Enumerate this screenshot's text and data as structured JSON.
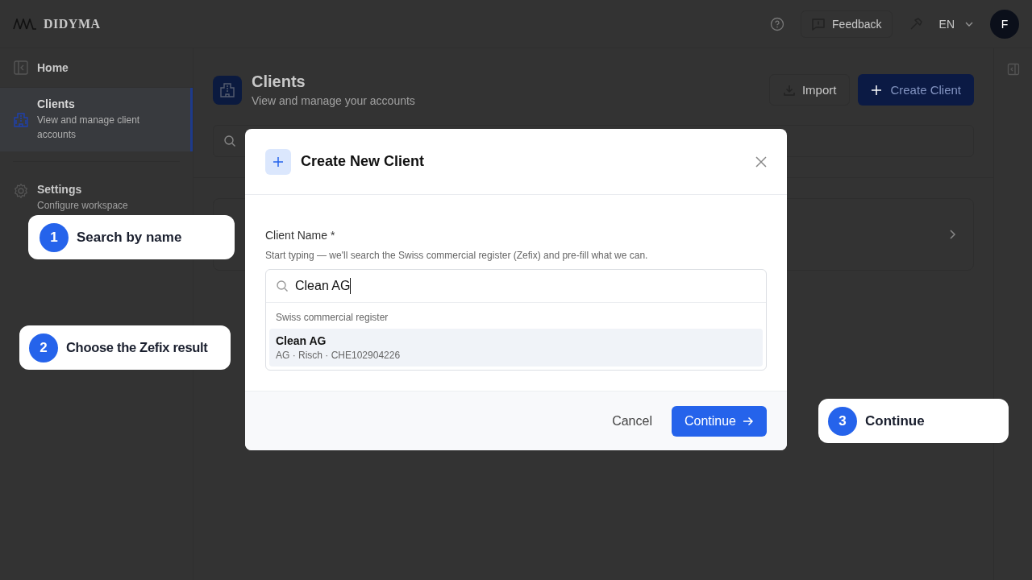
{
  "header": {
    "logo": "DIDYMA",
    "feedback": "Feedback",
    "language": "EN",
    "avatar": "F"
  },
  "sidebar": {
    "items": [
      {
        "kind": "home",
        "label": "Home",
        "selected": false
      },
      {
        "kind": "clients",
        "label": "Clients",
        "subtitle": "View and manage client accounts",
        "selected": true
      },
      {
        "kind": "settings",
        "label": "Settings",
        "subtitle": "Configure workspace",
        "selected": false
      }
    ]
  },
  "page": {
    "title": "Clients",
    "subtitle": "View and manage your accounts",
    "import_button": "Import",
    "create_button": "Create Client"
  },
  "dialog": {
    "title": "Create New Client",
    "field_label": "Client Name *",
    "hint": "Start typing — we'll search the Swiss commercial register (Zefix) and pre-fill what we can.",
    "value": "Clean AG",
    "group": "Swiss commercial register",
    "results": [
      {
        "name": "Clean AG",
        "detail": "AG · Risch · CHE102904226",
        "selected": true
      }
    ],
    "cancel": "Cancel",
    "continue": "Continue"
  },
  "callouts": [
    {
      "number": "1",
      "text": "Search by name"
    },
    {
      "number": "2",
      "text": "Choose the Zefix result"
    },
    {
      "number": "3",
      "text": "Continue"
    }
  ]
}
